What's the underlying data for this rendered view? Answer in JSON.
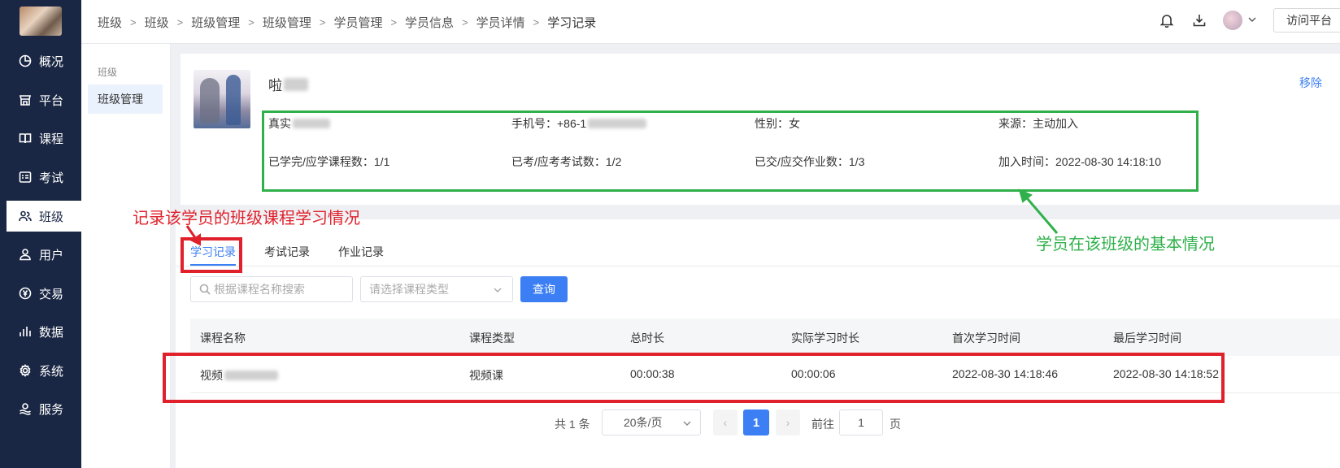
{
  "nav": {
    "items": [
      {
        "label": "概况",
        "icon": "chart-pie-icon"
      },
      {
        "label": "平台",
        "icon": "store-icon"
      },
      {
        "label": "课程",
        "icon": "book-icon"
      },
      {
        "label": "考试",
        "icon": "exam-icon"
      },
      {
        "label": "班级",
        "icon": "class-icon"
      },
      {
        "label": "用户",
        "icon": "user-icon"
      },
      {
        "label": "交易",
        "icon": "yen-icon"
      },
      {
        "label": "数据",
        "icon": "bar-chart-icon"
      },
      {
        "label": "系统",
        "icon": "gear-icon"
      },
      {
        "label": "服务",
        "icon": "service-icon"
      }
    ],
    "active_index": 4
  },
  "breadcrumb": [
    "班级",
    "班级",
    "班级管理",
    "班级管理",
    "学员管理",
    "学员信息",
    "学员详情",
    "学习记录"
  ],
  "topbar": {
    "visit_label": "访问平台"
  },
  "subnav": {
    "group_label": "班级",
    "item_label": "班级管理"
  },
  "student": {
    "name_visible": "啦",
    "remove_label": "移除",
    "fields": {
      "real_name_label": "真实",
      "phone_label": "手机号：+86-1",
      "gender": "性别：女",
      "source": "来源：主动加入",
      "courses": "已学完/应学课程数：1/1",
      "exams": "已考/应考考试数：1/2",
      "homework": "已交/应交作业数：1/3",
      "join_time": "加入时间：2022-08-30 14:18:10"
    }
  },
  "annotations": {
    "green_note": "学员在该班级的基本情况",
    "red_note": "记录该学员的班级课程学习情况",
    "green_color": "#2fb04a",
    "red_color": "#e0202a"
  },
  "tabs": [
    {
      "label": "学习记录"
    },
    {
      "label": "考试记录"
    },
    {
      "label": "作业记录"
    }
  ],
  "filters": {
    "search_placeholder": "根据课程名称搜索",
    "type_placeholder": "请选择课程类型",
    "query_label": "查询"
  },
  "table": {
    "headers": [
      "课程名称",
      "课程类型",
      "总时长",
      "实际学习时长",
      "首次学习时间",
      "最后学习时间"
    ],
    "rows": [
      {
        "name": "视频",
        "type": "视频课",
        "total": "00:00:38",
        "actual": "00:00:06",
        "first": "2022-08-30 14:18:46",
        "last": "2022-08-30 14:18:52"
      }
    ]
  },
  "pagination": {
    "total_text": "共 1 条",
    "page_size": "20条/页",
    "current_page": "1",
    "goto_label": "前往",
    "goto_value": "1",
    "page_suffix": "页"
  },
  "colors": {
    "nav_bg": "#1a2744",
    "accent": "#3c7ff4"
  }
}
